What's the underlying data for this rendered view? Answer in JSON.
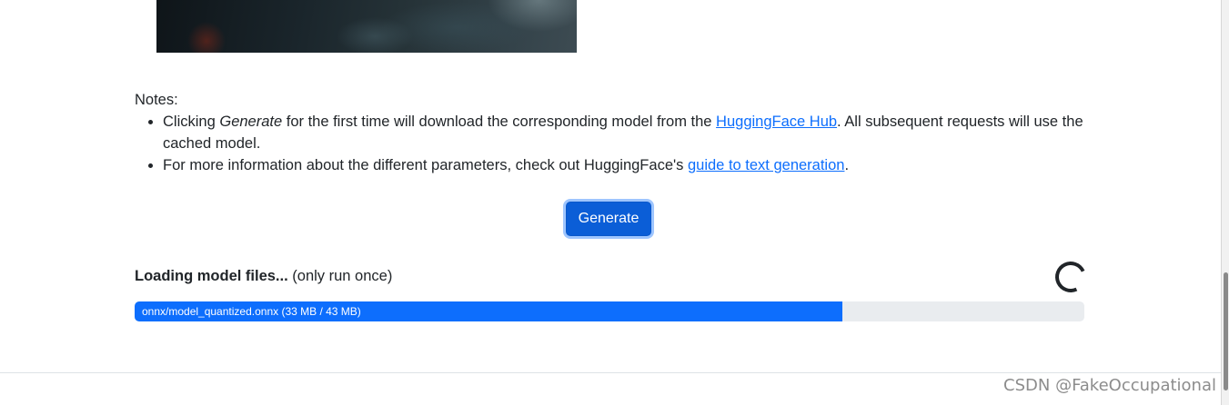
{
  "notes": {
    "title": "Notes:",
    "item1": {
      "before": "Clicking ",
      "em": "Generate",
      "middle": " for the first time will download the corresponding model from the ",
      "link": "HuggingFace Hub",
      "after": ". All subsequent requests will use the cached model."
    },
    "item2": {
      "before": "For more information about the different parameters, check out HuggingFace's ",
      "link": "guide to text generation",
      "after": "."
    }
  },
  "generate_label": "Generate",
  "loading": {
    "bold": "Loading model files...",
    "rest": " (only run once)"
  },
  "progress": {
    "label": "onnx/model_quantized.onnx (33 MB / 43 MB)",
    "fraction": 0.7453
  },
  "watermark": "CSDN @FakeOccupational",
  "colors": {
    "accent": "#0d6efd",
    "button": "#0b5ed7",
    "track": "#e9ecef"
  }
}
